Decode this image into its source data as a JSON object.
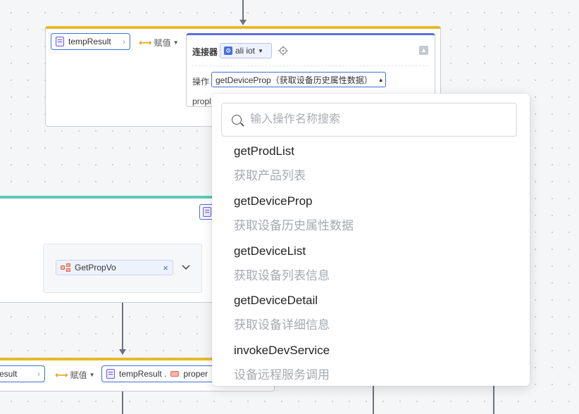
{
  "top_node": {
    "var_chip": "tempResult",
    "assign_label": "赋值",
    "connector_label": "连接器",
    "connector_value": "ali iot",
    "operation_label": "操作",
    "operation_value": "getDeviceProp（获取设备历史属性数据）",
    "partial_label": "propl"
  },
  "middle_node": {
    "struct_value": "GetPropVo"
  },
  "bottom_node": {
    "var_chip": "esult",
    "assign_label": "赋值",
    "target_var": "tempResult .",
    "target_prop": "proper"
  },
  "dropdown": {
    "search_placeholder": "输入操作名称搜索",
    "options": [
      {
        "name": "getProdList",
        "desc": "获取产品列表"
      },
      {
        "name": "getDeviceProp",
        "desc": "获取设备历史属性数据"
      },
      {
        "name": "getDeviceList",
        "desc": "获取设备列表信息"
      },
      {
        "name": "getDeviceDetail",
        "desc": "获取设备详细信息"
      },
      {
        "name": "invokeDevService",
        "desc": "设备远程服务调用"
      }
    ]
  },
  "colors": {
    "accent_yellow": "#e6b92a",
    "accent_teal": "#5ec9b8",
    "accent_blue": "#3b6fd8"
  }
}
